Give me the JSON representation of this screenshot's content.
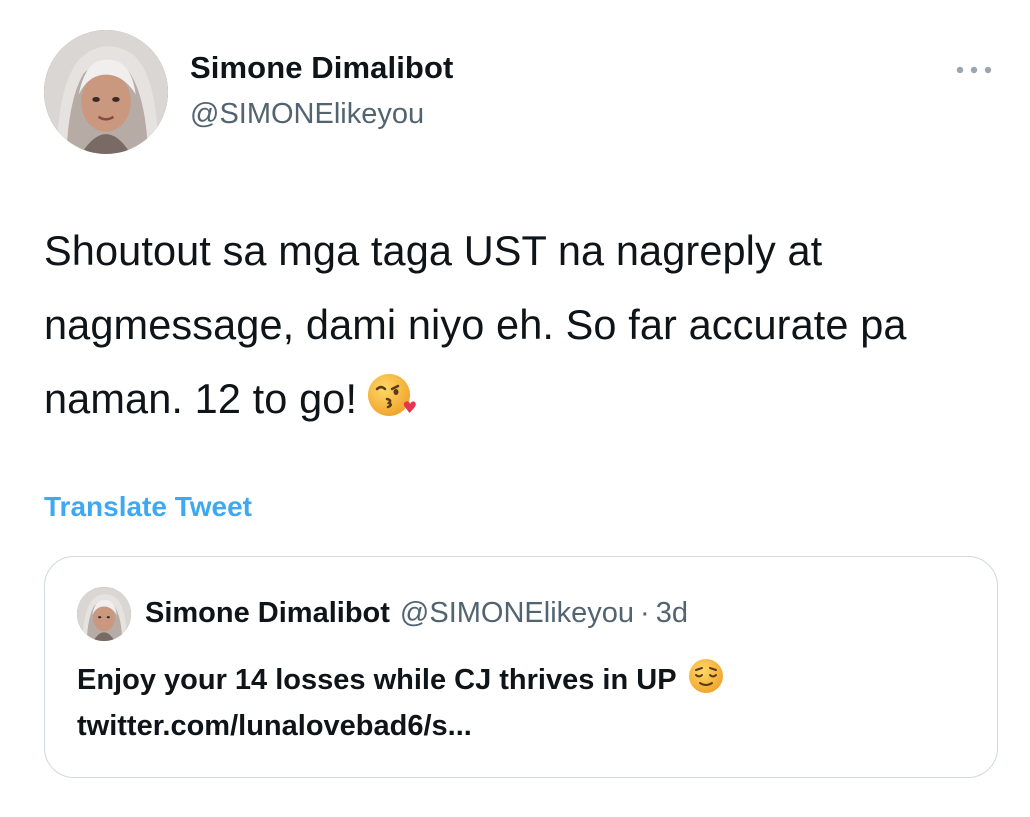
{
  "tweet": {
    "author": {
      "name": "Simone Dimalibot",
      "handle": "@SIMONElikeyou"
    },
    "text": "Shoutout sa mga taga UST na nagreply at nagmessage, dami niyo eh. So far accurate pa naman. 12 to go!",
    "text_emoji": "kissing-face-with-heart-emoji",
    "translate_label": "Translate Tweet",
    "more_icon": "more-dots-icon",
    "quote": {
      "name": "Simone Dimalibot",
      "handle": "@SIMONElikeyou",
      "separator": "·",
      "time": "3d",
      "text": "Enjoy your 14 losses while CJ thrives in UP",
      "text_emoji": "relieved-face-emoji",
      "link": "twitter.com/lunalovebad6/s..."
    }
  },
  "colors": {
    "link_blue": "#1d9bf0",
    "secondary_text": "#536471",
    "border": "#cfd9de",
    "text": "#0f1419"
  }
}
